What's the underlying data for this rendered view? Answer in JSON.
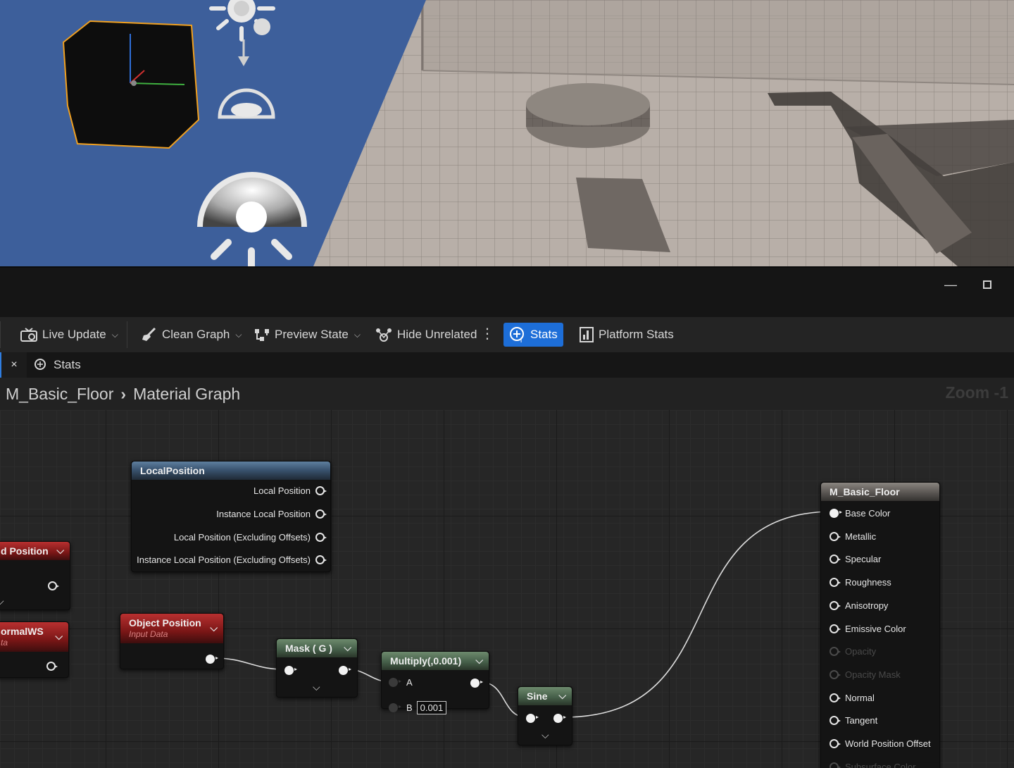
{
  "window": {
    "minimize_icon": "minimize-icon",
    "maximize_icon": "maximize-icon"
  },
  "toolbar": {
    "live_update": "Live Update",
    "clean_graph": "Clean Graph",
    "preview_state": "Preview State",
    "hide_unrelated": "Hide Unrelated",
    "stats": "Stats",
    "platform_stats": "Platform Stats",
    "active_color": "#1d6ed8"
  },
  "tab": {
    "close": "×",
    "label": "Stats"
  },
  "breadcrumb": {
    "asset": "M_Basic_Floor",
    "separator": "›",
    "graph": "Material Graph",
    "zoom": "Zoom -1"
  },
  "nodes": {
    "local_position": {
      "title": "LocalPosition",
      "outputs": [
        "Local Position",
        "Instance Local Position",
        "Local Position (Excluding Offsets)",
        "Instance Local Position (Excluding Offsets)"
      ]
    },
    "world_position": {
      "title": "d Position"
    },
    "normal_ws": {
      "title": "ormalWS",
      "subtitle": "ta"
    },
    "object_position": {
      "title": "Object Position",
      "subtitle": "Input Data"
    },
    "mask": {
      "title": "Mask ( G )"
    },
    "multiply": {
      "title": "Multiply(,0.001)",
      "pin_a": "A",
      "pin_b": "B",
      "b_value": "0.001"
    },
    "sine": {
      "title": "Sine"
    },
    "material_output": {
      "title": "M_Basic_Floor",
      "inputs": [
        {
          "label": "Base Color",
          "connected": true,
          "enabled": true
        },
        {
          "label": "Metallic",
          "connected": false,
          "enabled": true
        },
        {
          "label": "Specular",
          "connected": false,
          "enabled": true
        },
        {
          "label": "Roughness",
          "connected": false,
          "enabled": true
        },
        {
          "label": "Anisotropy",
          "connected": false,
          "enabled": true
        },
        {
          "label": "Emissive Color",
          "connected": false,
          "enabled": true
        },
        {
          "label": "Opacity",
          "connected": false,
          "enabled": false
        },
        {
          "label": "Opacity Mask",
          "connected": false,
          "enabled": false
        },
        {
          "label": "Normal",
          "connected": false,
          "enabled": true
        },
        {
          "label": "Tangent",
          "connected": false,
          "enabled": true
        },
        {
          "label": "World Position Offset",
          "connected": false,
          "enabled": true
        },
        {
          "label": "Subsurface Color",
          "connected": false,
          "enabled": false
        }
      ]
    }
  },
  "viewport_colors": {
    "sky": "#3d5f9b",
    "floor": "#b9b1aa",
    "selection_outline": "#f0a020"
  }
}
